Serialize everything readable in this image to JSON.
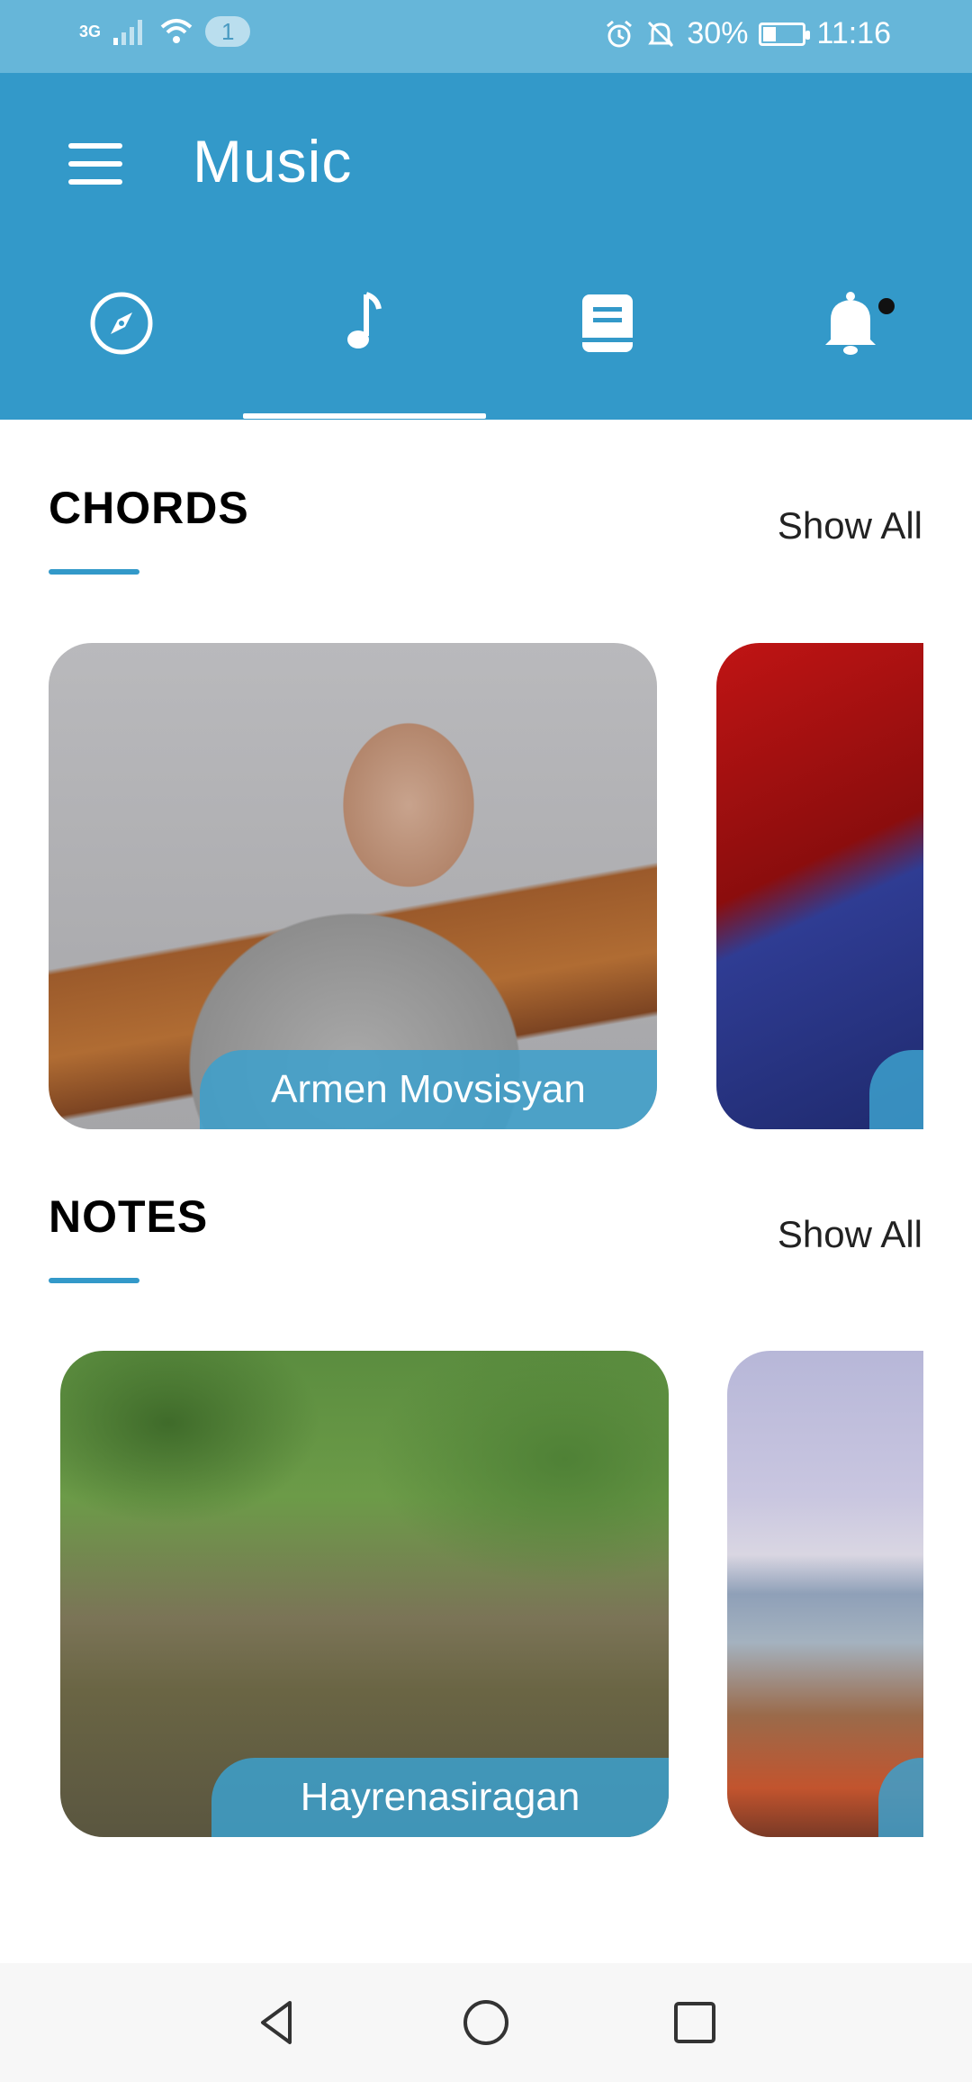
{
  "status_bar": {
    "network": "3G",
    "notification_count": "1",
    "battery": "30%",
    "time": "11:16",
    "icons": [
      "signal-icon",
      "wifi-icon",
      "alarm-icon",
      "mute-icon",
      "battery-icon"
    ]
  },
  "header": {
    "title": "Music",
    "tabs": [
      {
        "name": "explore",
        "icon": "compass-icon",
        "active": false
      },
      {
        "name": "music",
        "icon": "music-note-icon",
        "active": true
      },
      {
        "name": "library",
        "icon": "book-icon",
        "active": false
      },
      {
        "name": "notifications",
        "icon": "bell-icon",
        "active": false,
        "has_dot": true
      }
    ]
  },
  "sections": {
    "chords": {
      "title": "CHORDS",
      "show_all": "Show All",
      "cards": [
        {
          "label": "Armen Movsisyan"
        },
        {
          "label": ""
        }
      ]
    },
    "notes": {
      "title": "NOTES",
      "show_all": "Show All",
      "cards": [
        {
          "label": "Hayrenasiragan"
        },
        {
          "label": ""
        }
      ]
    }
  },
  "colors": {
    "primary": "#3399c9",
    "status_bar": "#66b6d9",
    "card_label": "#3ca0cd"
  }
}
